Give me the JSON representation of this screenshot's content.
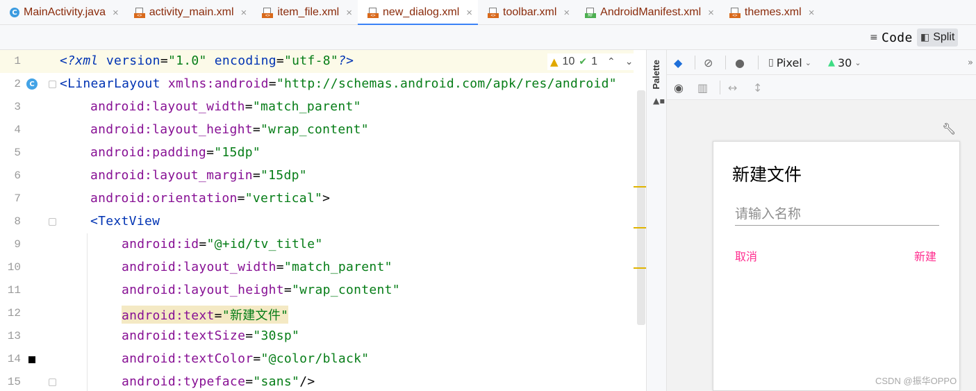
{
  "tabs": [
    {
      "label": "MainActivity.java",
      "icon": "java-class-icon"
    },
    {
      "label": "activity_main.xml",
      "icon": "xml-file-icon"
    },
    {
      "label": "item_file.xml",
      "icon": "xml-file-icon"
    },
    {
      "label": "new_dialog.xml",
      "icon": "xml-file-icon",
      "active": true
    },
    {
      "label": "toolbar.xml",
      "icon": "xml-file-icon"
    },
    {
      "label": "AndroidManifest.xml",
      "icon": "manifest-file-icon"
    },
    {
      "label": "themes.xml",
      "icon": "xml-file-icon"
    }
  ],
  "tab_close": "×",
  "view_modes": {
    "code": "Code",
    "split": "Split",
    "active": "Split"
  },
  "inspections": {
    "warnings": "10",
    "weak_warnings": "1"
  },
  "editor": {
    "lines": [
      {
        "n": "1"
      },
      {
        "n": "2"
      },
      {
        "n": "3"
      },
      {
        "n": "4"
      },
      {
        "n": "5"
      },
      {
        "n": "6"
      },
      {
        "n": "7"
      },
      {
        "n": "8"
      },
      {
        "n": "9"
      },
      {
        "n": "10"
      },
      {
        "n": "11"
      },
      {
        "n": "12"
      },
      {
        "n": "13"
      },
      {
        "n": "14"
      },
      {
        "n": "15"
      }
    ],
    "code": {
      "l1": {
        "open": "<?",
        "kw": "xml",
        "attr1": "version",
        "val1": "\"1.0\"",
        "attr2": "encoding",
        "val2": "\"utf-8\"",
        "close": "?>"
      },
      "l2": {
        "tag": "<LinearLayout",
        "attr": "xmlns:android",
        "val": "\"http://schemas.android.com/apk/res/android\""
      },
      "l3": {
        "ns": "android:",
        "attr": "layout_width",
        "val": "\"match_parent\""
      },
      "l4": {
        "ns": "android:",
        "attr": "layout_height",
        "val": "\"wrap_content\""
      },
      "l5": {
        "ns": "android:",
        "attr": "padding",
        "val": "\"15dp\""
      },
      "l6": {
        "ns": "android:",
        "attr": "layout_margin",
        "val": "\"15dp\""
      },
      "l7": {
        "ns": "android:",
        "attr": "orientation",
        "val": "\"vertical\"",
        "tail": ">"
      },
      "l8": {
        "tag": "<TextView"
      },
      "l9": {
        "ns": "android:",
        "attr": "id",
        "val": "\"@+id/tv_title\""
      },
      "l10": {
        "ns": "android:",
        "attr": "layout_width",
        "val": "\"match_parent\""
      },
      "l11": {
        "ns": "android:",
        "attr": "layout_height",
        "val": "\"wrap_content\""
      },
      "l12": {
        "ns": "android:",
        "attr": "text",
        "val": "\"新建文件\""
      },
      "l13": {
        "ns": "android:",
        "attr": "textSize",
        "val": "\"30sp\""
      },
      "l14": {
        "ns": "android:",
        "attr": "textColor",
        "val": "\"@color/black\""
      },
      "l15": {
        "ns": "android:",
        "attr": "typeface",
        "val": "\"sans\"",
        "tail": "/>"
      }
    },
    "eq": "="
  },
  "palette_label": "Palette",
  "design_toolbar": {
    "device": "Pixel",
    "api": "30",
    "overflow": "»"
  },
  "preview": {
    "title": "新建文件",
    "input_hint": "请输入名称",
    "cancel": "取消",
    "create": "新建"
  },
  "colors": {
    "accent_pink": "#ff2e8f",
    "tab_underline": "#3b82f6",
    "xml_tag": "#0033b3",
    "xml_attr": "#871094",
    "xml_value": "#067d17"
  },
  "watermark": "CSDN @振华OPPO"
}
